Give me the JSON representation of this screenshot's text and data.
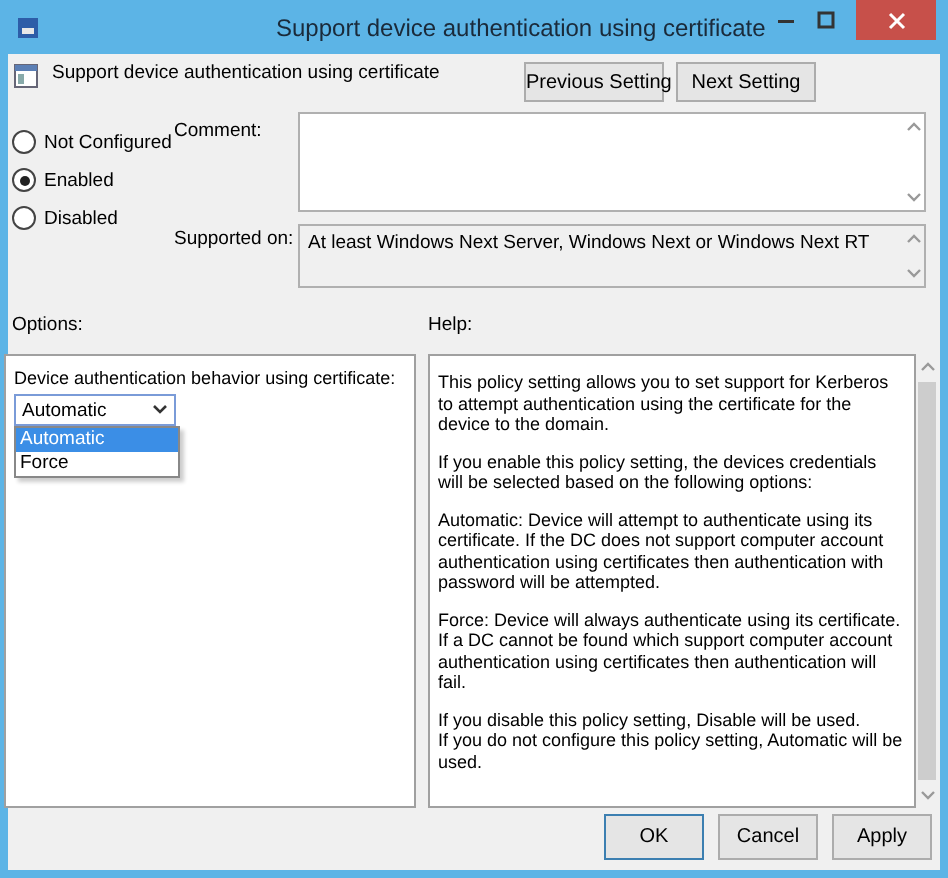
{
  "window": {
    "title": "Support device authentication using certificate"
  },
  "header": {
    "title": "Support device authentication using certificate",
    "buttons": [
      "Previous Setting",
      "Next Setting"
    ]
  },
  "states": [
    {
      "label": "Not Configured",
      "selected": false
    },
    {
      "label": "Enabled",
      "selected": true
    },
    {
      "label": "Disabled",
      "selected": false
    }
  ],
  "comment": {
    "label": "Comment:"
  },
  "supported_on": {
    "label": "Supported on:",
    "value": "At least Windows Next Server, Windows Next or Windows Next RT"
  },
  "options": {
    "label": "Options:",
    "field_label": "Device authentication behavior using certificate:",
    "dropdown": {
      "value": "Automatic",
      "expanded": true,
      "items": [
        {
          "label": "Automatic",
          "selected": true
        },
        {
          "label": "Force",
          "selected": false
        }
      ]
    }
  },
  "help": {
    "label": "Help:",
    "paragraphs": [
      "This policy setting allows you to set support for Kerberos to attempt authentication using the certificate for the device to the domain.",
      "If you enable this policy setting, the devices credentials will be selected based on the following options:",
      "Automatic: Device will attempt to authenticate using its certificate. If the DC does not support computer account authentication using certificates then authentication with password will be attempted.",
      "Force: Device will always authenticate using its certificate. If a DC cannot be found which support computer account authentication using certificates then authentication will fail.",
      "If you disable this policy setting, Disable will be used.\nIf you do not configure this policy setting, Automatic will be used."
    ]
  },
  "buttons": [
    "OK",
    "Cancel",
    "Apply"
  ]
}
